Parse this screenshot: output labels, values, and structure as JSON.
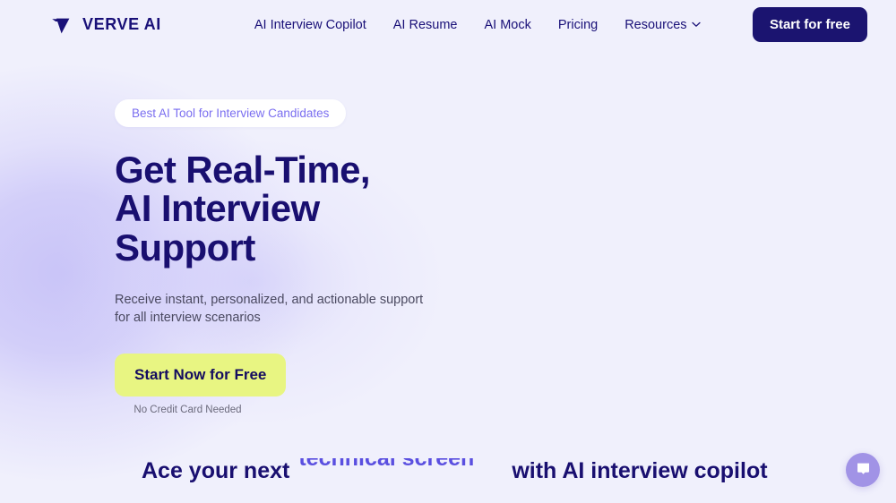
{
  "colors": {
    "page_background": "#f0f0fc",
    "brand_navy": "#191078",
    "accent_purple": "#7a6ef0",
    "rotator_purple": "#5a4fe0",
    "cta_yellow": "#e8f582",
    "nav_cta_navy": "#1b1470",
    "chat_purple": "#a193e6",
    "glow_purple": "#c9c4f8"
  },
  "header": {
    "brand": {
      "name": "VERVE AI",
      "logo_icon": "verve-v-logo-icon"
    },
    "nav_items": [
      {
        "label": "AI Interview Copilot",
        "has_dropdown": false
      },
      {
        "label": "AI Resume",
        "has_dropdown": false
      },
      {
        "label": "AI Mock",
        "has_dropdown": false
      },
      {
        "label": "Pricing",
        "has_dropdown": false
      },
      {
        "label": "Resources",
        "has_dropdown": true
      }
    ],
    "cta_label": "Start for free"
  },
  "hero": {
    "badge_label": "Best AI Tool for Interview Candidates",
    "headline_lines": [
      "Get Real-Time,",
      "AI Interview",
      "Support"
    ],
    "subtitle_lines": [
      "Receive instant, personalized, and actionable support",
      "for all interview scenarios"
    ],
    "cta_label": "Start Now for Free",
    "cta_note": "No Credit Card Needed"
  },
  "banner": {
    "prefix": "Ace your next",
    "rotating_word": "technical screen",
    "suffix": "with AI interview copilot"
  },
  "chat_widget": {
    "icon": "chat-message-icon",
    "label": "Open chat"
  }
}
